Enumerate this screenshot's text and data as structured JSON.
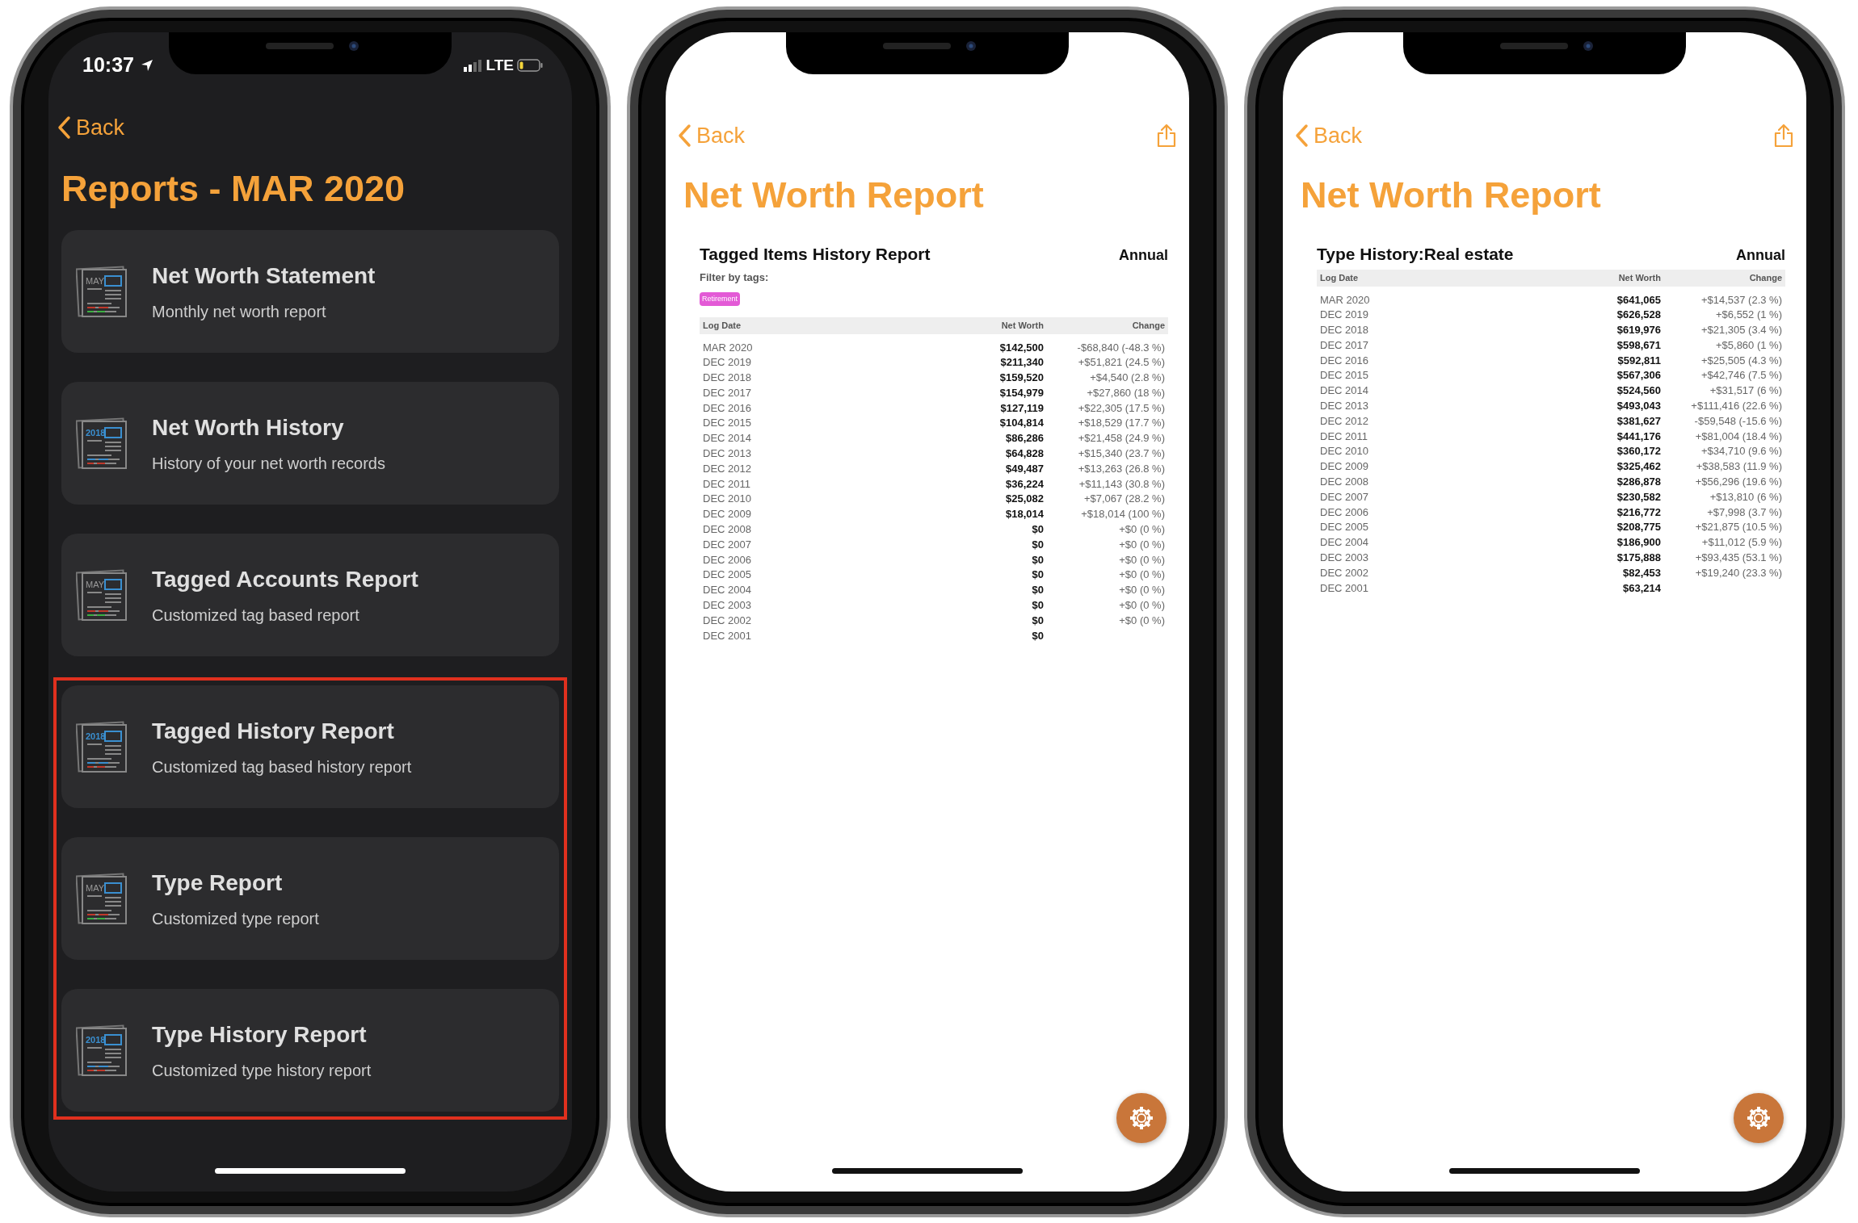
{
  "phones": [
    {
      "kind": "list",
      "status_bar": {
        "time": "10:37",
        "network": "LTE"
      },
      "back": "Back",
      "title": "Reports - MAR 2020",
      "items": [
        {
          "title": "Net Worth Statement",
          "subtitle": "Monthly net worth report",
          "icon_text": "MAY",
          "highlighted": false
        },
        {
          "title": "Net Worth History",
          "subtitle": "History of your net worth records",
          "icon_text": "2018",
          "highlighted": false
        },
        {
          "title": "Tagged Accounts Report",
          "subtitle": "Customized tag based report",
          "icon_text": "MAY",
          "highlighted": false
        },
        {
          "title": "Tagged History Report",
          "subtitle": "Customized tag based history report",
          "icon_text": "2018",
          "highlighted": true
        },
        {
          "title": "Type Report",
          "subtitle": "Customized type report",
          "icon_text": "MAY",
          "highlighted": true
        },
        {
          "title": "Type History Report",
          "subtitle": "Customized type history report",
          "icon_text": "2018",
          "highlighted": true
        }
      ]
    },
    {
      "kind": "report",
      "back": "Back",
      "title": "Net Worth Report",
      "report": {
        "title": "Tagged Items History Report",
        "period": "Annual",
        "filter_label": "Filter by tags:",
        "tags": [
          {
            "label": "Retirement",
            "color": "#e35ad6"
          }
        ],
        "columns": [
          "Log Date",
          "Net Worth",
          "Change"
        ],
        "rows": [
          {
            "date": "MAR 2020",
            "net_worth": "$142,500",
            "change": "-$68,840 (-48.3 %)"
          },
          {
            "date": "DEC 2019",
            "net_worth": "$211,340",
            "change": "+$51,821 (24.5 %)"
          },
          {
            "date": "DEC 2018",
            "net_worth": "$159,520",
            "change": "+$4,540 (2.8 %)"
          },
          {
            "date": "DEC 2017",
            "net_worth": "$154,979",
            "change": "+$27,860 (18 %)"
          },
          {
            "date": "DEC 2016",
            "net_worth": "$127,119",
            "change": "+$22,305 (17.5 %)"
          },
          {
            "date": "DEC 2015",
            "net_worth": "$104,814",
            "change": "+$18,529 (17.7 %)"
          },
          {
            "date": "DEC 2014",
            "net_worth": "$86,286",
            "change": "+$21,458 (24.9 %)"
          },
          {
            "date": "DEC 2013",
            "net_worth": "$64,828",
            "change": "+$15,340 (23.7 %)"
          },
          {
            "date": "DEC 2012",
            "net_worth": "$49,487",
            "change": "+$13,263 (26.8 %)"
          },
          {
            "date": "DEC 2011",
            "net_worth": "$36,224",
            "change": "+$11,143 (30.8 %)"
          },
          {
            "date": "DEC 2010",
            "net_worth": "$25,082",
            "change": "+$7,067 (28.2 %)"
          },
          {
            "date": "DEC 2009",
            "net_worth": "$18,014",
            "change": "+$18,014 (100 %)"
          },
          {
            "date": "DEC 2008",
            "net_worth": "$0",
            "change": "+$0 (0 %)"
          },
          {
            "date": "DEC 2007",
            "net_worth": "$0",
            "change": "+$0 (0 %)"
          },
          {
            "date": "DEC 2006",
            "net_worth": "$0",
            "change": "+$0 (0 %)"
          },
          {
            "date": "DEC 2005",
            "net_worth": "$0",
            "change": "+$0 (0 %)"
          },
          {
            "date": "DEC 2004",
            "net_worth": "$0",
            "change": "+$0 (0 %)"
          },
          {
            "date": "DEC 2003",
            "net_worth": "$0",
            "change": "+$0 (0 %)"
          },
          {
            "date": "DEC 2002",
            "net_worth": "$0",
            "change": "+$0 (0 %)"
          },
          {
            "date": "DEC 2001",
            "net_worth": "$0"
          }
        ]
      }
    },
    {
      "kind": "report",
      "back": "Back",
      "title": "Net Worth Report",
      "report": {
        "title": "Type History:Real estate",
        "period": "Annual",
        "columns": [
          "Log Date",
          "Net Worth",
          "Change"
        ],
        "rows": [
          {
            "date": "MAR 2020",
            "net_worth": "$641,065",
            "change": "+$14,537 (2.3 %)"
          },
          {
            "date": "DEC 2019",
            "net_worth": "$626,528",
            "change": "+$6,552 (1 %)"
          },
          {
            "date": "DEC 2018",
            "net_worth": "$619,976",
            "change": "+$21,305 (3.4 %)"
          },
          {
            "date": "DEC 2017",
            "net_worth": "$598,671",
            "change": "+$5,860 (1 %)"
          },
          {
            "date": "DEC 2016",
            "net_worth": "$592,811",
            "change": "+$25,505 (4.3 %)"
          },
          {
            "date": "DEC 2015",
            "net_worth": "$567,306",
            "change": "+$42,746 (7.5 %)"
          },
          {
            "date": "DEC 2014",
            "net_worth": "$524,560",
            "change": "+$31,517 (6 %)"
          },
          {
            "date": "DEC 2013",
            "net_worth": "$493,043",
            "change": "+$111,416 (22.6 %)"
          },
          {
            "date": "DEC 2012",
            "net_worth": "$381,627",
            "change": "-$59,548 (-15.6 %)"
          },
          {
            "date": "DEC 2011",
            "net_worth": "$441,176",
            "change": "+$81,004 (18.4 %)"
          },
          {
            "date": "DEC 2010",
            "net_worth": "$360,172",
            "change": "+$34,710 (9.6 %)"
          },
          {
            "date": "DEC 2009",
            "net_worth": "$325,462",
            "change": "+$38,583 (11.9 %)"
          },
          {
            "date": "DEC 2008",
            "net_worth": "$286,878",
            "change": "+$56,296 (19.6 %)"
          },
          {
            "date": "DEC 2007",
            "net_worth": "$230,582",
            "change": "+$13,810 (6 %)"
          },
          {
            "date": "DEC 2006",
            "net_worth": "$216,772",
            "change": "+$7,998 (3.7 %)"
          },
          {
            "date": "DEC 2005",
            "net_worth": "$208,775",
            "change": "+$21,875 (10.5 %)"
          },
          {
            "date": "DEC 2004",
            "net_worth": "$186,900",
            "change": "+$11,012 (5.9 %)"
          },
          {
            "date": "DEC 2003",
            "net_worth": "$175,888",
            "change": "+$93,435 (53.1 %)"
          },
          {
            "date": "DEC 2002",
            "net_worth": "$82,453",
            "change": "+$19,240 (23.3 %)"
          },
          {
            "date": "DEC 2001",
            "net_worth": "$63,214"
          }
        ]
      }
    }
  ]
}
